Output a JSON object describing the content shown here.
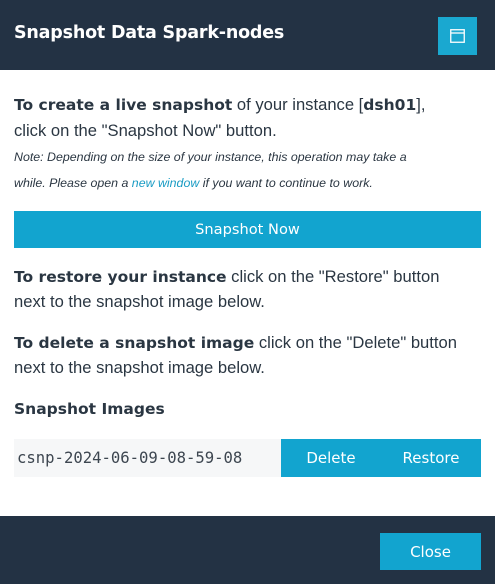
{
  "dialog": {
    "title": "Snapshot Data Spark-nodes",
    "maximize_icon": "window-maximize-icon"
  },
  "create": {
    "bold": "To create a live snapshot",
    "text1": " of your instance [",
    "instance": "dsh01",
    "text2": "],",
    "line2": "click on the \"Snapshot Now\" button.",
    "note1": "Note: Depending on the size of your instance, this operation may take a",
    "note2_pre": "while. Please open a ",
    "note2_link": "new window",
    "note2_post": " if you want to continue to work."
  },
  "snapshot_now_label": "Snapshot Now",
  "restore": {
    "bold": "To restore your instance",
    "text": " click on the \"Restore\" button",
    "line2": "next to the snapshot image below."
  },
  "delete": {
    "bold": "To delete a snapshot image",
    "text": " click on the \"Delete\" button",
    "line2": "next to the snapshot image below."
  },
  "images": {
    "heading": "Snapshot Images",
    "items": [
      {
        "name": "csnp-2024-06-09-08-59-08",
        "delete_label": "Delete",
        "restore_label": "Restore"
      }
    ]
  },
  "footer": {
    "close_label": "Close"
  },
  "colors": {
    "header_bg": "#233244",
    "accent": "#12a4cf",
    "link": "#1a9cc4",
    "text": "#2a3642"
  }
}
